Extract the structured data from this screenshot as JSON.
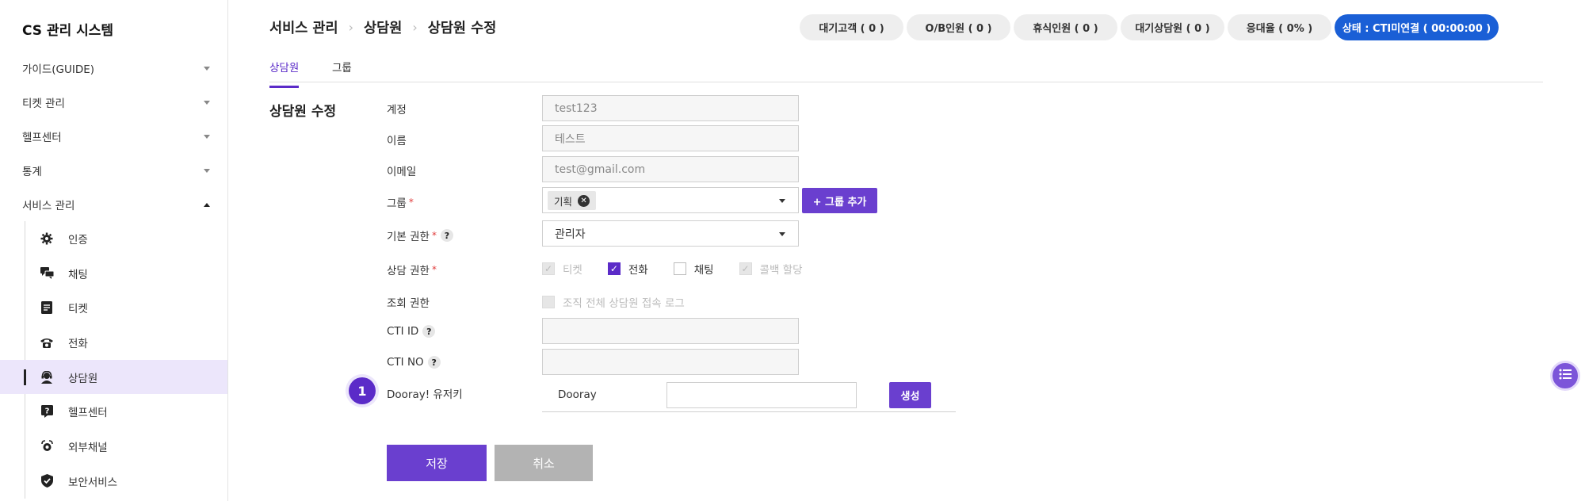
{
  "sidebar": {
    "title": "CS 관리 시스템",
    "menu": [
      {
        "label": "가이드(GUIDE)"
      },
      {
        "label": "티켓 관리"
      },
      {
        "label": "헬프센터"
      },
      {
        "label": "통계"
      },
      {
        "label": "서비스 관리"
      }
    ],
    "submenu": [
      {
        "label": "인증",
        "icon": "gear-icon"
      },
      {
        "label": "채팅",
        "icon": "chat-icon"
      },
      {
        "label": "티켓",
        "icon": "ticket-icon"
      },
      {
        "label": "전화",
        "icon": "phone-icon"
      },
      {
        "label": "상담원",
        "icon": "agent-icon"
      },
      {
        "label": "헬프센터",
        "icon": "help-icon"
      },
      {
        "label": "외부채널",
        "icon": "channel-icon"
      },
      {
        "label": "보안서비스",
        "icon": "shield-icon"
      }
    ]
  },
  "header": {
    "breadcrumb": [
      "서비스 관리",
      "상담원",
      "상담원 수정"
    ],
    "status": [
      "대기고객 ( 0 )",
      "O/B인원 ( 0 )",
      "휴식인원 ( 0 )",
      "대기상담원 ( 0 )",
      "응대율 ( 0% )",
      "상태 : CTI미연결 ( 00:00:00 )"
    ]
  },
  "tabs": [
    "상담원",
    "그룹"
  ],
  "form": {
    "section_title": "상담원 수정",
    "account_label": "계정",
    "account_value": "test123",
    "name_label": "이름",
    "name_value": "테스트",
    "email_label": "이메일",
    "email_value": "test@gmail.com",
    "group_label": "그룹",
    "group_chip": "기획",
    "group_add_button": "+ 그룹 추가",
    "role_label": "기본 권한",
    "role_value": "관리자",
    "consult_label": "상담 권한",
    "consult_options": [
      {
        "label": "티켓",
        "state": "checked-disabled"
      },
      {
        "label": "전화",
        "state": "checked"
      },
      {
        "label": "채팅",
        "state": "unchecked"
      },
      {
        "label": "콜백 할당",
        "state": "checked-disabled"
      }
    ],
    "view_label": "조회 권한",
    "view_option": "조직 전체 상담원 접속 로그",
    "cti_id_label": "CTI ID",
    "cti_no_label": "CTI NO",
    "dooray_label": "Dooray! 유저키",
    "dooray_field_label": "Dooray",
    "generate_button": "생성",
    "step_number": "1",
    "save_button": "저장",
    "cancel_button": "취소",
    "required_mark": "*",
    "help_mark": "?"
  },
  "colors": {
    "accent": "#6a3fcf",
    "cti_pill": "#1a5fd6",
    "active_menu_bg": "#ece6fb"
  }
}
